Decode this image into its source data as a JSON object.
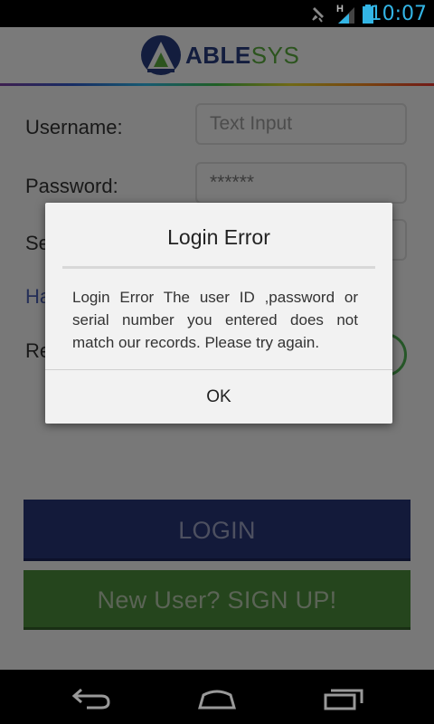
{
  "status_bar": {
    "time": "10:07",
    "network_type": "H",
    "icons": [
      "mute-icon",
      "signal-icon",
      "battery-icon"
    ],
    "accent_color": "#33b5e5"
  },
  "header": {
    "logo_part1": "ABLE",
    "logo_part2": "SYS",
    "logo_colors": {
      "able": "#263a7d",
      "sys": "#59a93c"
    }
  },
  "form": {
    "username_label": "Username:",
    "username_placeholder": "Text Input",
    "password_label": "Password:",
    "password_value": "******",
    "serial_label": "Se",
    "help_link": "Ha",
    "remember_label": "Re"
  },
  "buttons": {
    "login": "LOGIN",
    "signup": "New User? SIGN UP!",
    "login_color": "#273575",
    "signup_color": "#4a8b3a"
  },
  "dialog": {
    "title": "Login Error",
    "message": "Login Error  The user ID ,password or serial number you entered does not match our records. Please try again.",
    "ok_label": "OK"
  },
  "nav_bar": {
    "icons": [
      "back-icon",
      "home-icon",
      "recent-apps-icon"
    ]
  }
}
